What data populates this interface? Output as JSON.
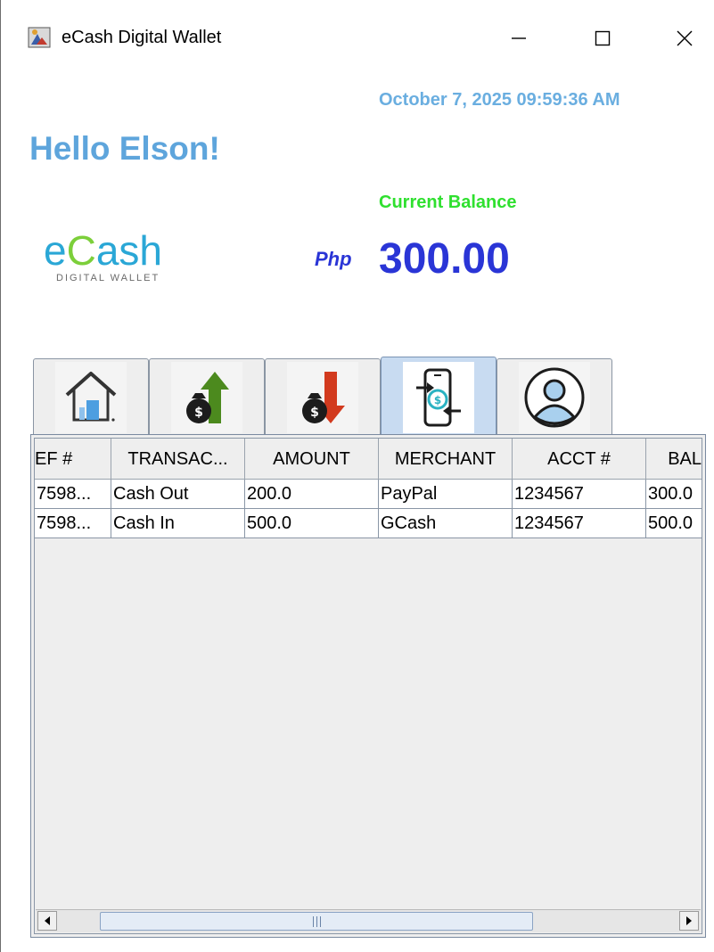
{
  "window": {
    "title": "eCash Digital Wallet"
  },
  "header": {
    "datetime": "October 7, 2025 09:59:36 AM",
    "greeting": "Hello Elson!",
    "balance_label": "Current Balance",
    "currency": "Php",
    "balance": "300.00"
  },
  "logo": {
    "word_e": "e",
    "word_c": "C",
    "word_rest": "ash",
    "tagline": "DIGITAL WALLET"
  },
  "tabs": [
    {
      "icon": "home-icon",
      "active": false
    },
    {
      "icon": "cash-in-icon",
      "active": false
    },
    {
      "icon": "cash-out-icon",
      "active": false
    },
    {
      "icon": "transactions-icon",
      "active": true
    },
    {
      "icon": "profile-icon",
      "active": false
    }
  ],
  "table": {
    "columns": [
      "EF #",
      "TRANSAC...",
      "AMOUNT",
      "MERCHANT",
      "ACCT #",
      "BAL"
    ],
    "rows": [
      [
        "7598...",
        "Cash Out",
        "200.0",
        "PayPal",
        "1234567",
        "300.0"
      ],
      [
        "7598...",
        "Cash In",
        "500.0",
        "GCash",
        "1234567",
        "500.0"
      ]
    ]
  },
  "colors": {
    "accent_blue": "#5ea5dc",
    "balance_blue": "#2a35d6",
    "balance_label_green": "#2fe02f",
    "active_tab": "#c8dbf1"
  }
}
